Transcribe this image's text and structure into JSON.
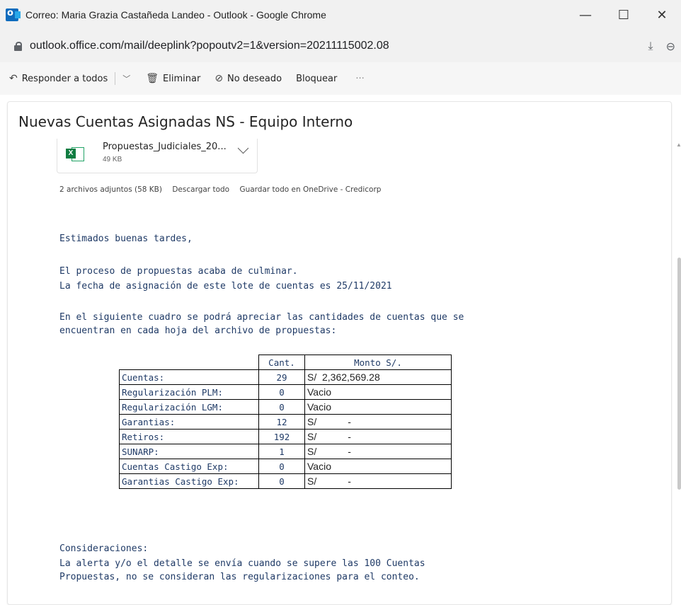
{
  "window": {
    "title": "Correo: Maria Grazia Castañeda Landeo - Outlook - Google Chrome",
    "controls": [
      "—",
      "☐",
      "✕"
    ]
  },
  "address": {
    "url": "outlook.office.com/mail/deeplink?popoutv2=1&version=20211115002.08"
  },
  "toolbar": {
    "reply_all": "Responder a todos",
    "delete": "Eliminar",
    "junk": "No deseado",
    "block": "Bloquear",
    "more": "···"
  },
  "email": {
    "subject": "Nuevas Cuentas Asignadas NS - Equipo Interno",
    "attachment": {
      "name": "Propuestas_Judiciales_20...",
      "size": "49 KB",
      "type_icon": "excel-icon"
    },
    "attachments_summary": {
      "count": "2 archivos adjuntos (58 KB)",
      "download_all": "Descargar todo",
      "save_onedrive": "Guardar todo en OneDrive - Credicorp"
    },
    "greeting": "Estimados buenas tardes,",
    "para1_line1": "El proceso de propuestas acaba de culminar.",
    "para1_line2": "La fecha de asignación de este lote de cuentas es 25/11/2021",
    "para2_line1": "En el siguiente cuadro se podrá apreciar las cantidades de cuentas que se",
    "para2_line2": "encuentran en cada hoja del archivo de propuestas:",
    "table": {
      "header_cant": "Cant.",
      "header_monto": "Monto S/.",
      "rows": [
        {
          "label": "Cuentas:",
          "cant": "29",
          "monto": "S/  2,362,569.28"
        },
        {
          "label": "Regularización PLM:",
          "cant": "0",
          "monto": "Vacio"
        },
        {
          "label": "Regularización LGM:",
          "cant": "0",
          "monto": "Vacio"
        },
        {
          "label": "Garantias:",
          "cant": "12",
          "monto": "S/",
          "dash": "-"
        },
        {
          "label": "Retiros:",
          "cant": "192",
          "monto": "S/",
          "dash": "-"
        },
        {
          "label": "SUNARP:",
          "cant": "1",
          "monto": "S/",
          "dash": "-"
        },
        {
          "label": "Cuentas Castigo Exp:",
          "cant": "0",
          "monto": "Vacio"
        },
        {
          "label": "Garantias Castigo Exp:",
          "cant": "0",
          "monto": "S/",
          "dash": "-"
        }
      ]
    },
    "considerations_title": "Consideraciones:",
    "considerations_line1": "La alerta y/o el detalle se envía cuando se supere las 100 Cuentas",
    "considerations_line2": "Propuestas, no se consideran las regularizaciones para el conteo."
  }
}
